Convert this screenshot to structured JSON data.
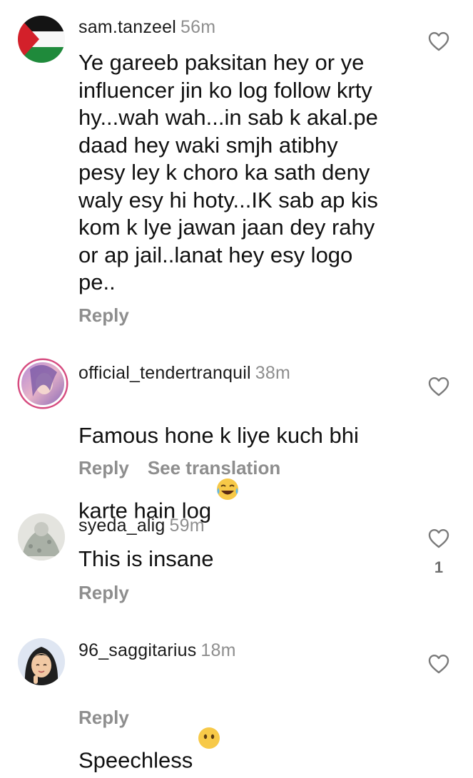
{
  "comments": [
    {
      "username": "sam.tanzeel",
      "time": "56m",
      "text": "Ye gareeb paksitan hey or ye\ninfluencer jin ko log follow krty\nhy...wah wah...in sab k akal.pe\ndaad hey waki smjh atibhy\npesy ley k choro ka sath deny\nwaly esy hi hoty...IK sab ap kis\nkom k lye jawan jaan dey rahy\nor ap jail..lanat hey esy logo\npe..",
      "reply_label": "Reply",
      "avatar_icon": "palestine-flag-icon"
    },
    {
      "username": "official_tendertranquil",
      "time": "38m",
      "text": "Famous hone k liye kuch bhi\nkarte hain log",
      "emoji": "tears-of-joy-emoji",
      "reply_label": "Reply",
      "translation_label": "See translation",
      "avatar_icon": "profile-photo-icon"
    },
    {
      "username": "syeda_alig",
      "time": "59m",
      "text": "This is insane",
      "reply_label": "Reply",
      "like_count": "1",
      "avatar_icon": "profile-photo-icon"
    },
    {
      "username": "96_saggitarius",
      "time": "18m",
      "text": "Speechless",
      "emoji": "no-mouth-face-emoji",
      "reply_label": "Reply",
      "avatar_icon": "cartoon-girl-avatar-icon"
    }
  ],
  "colors": {
    "secondary_text": "#8e8e8e",
    "story_ring": "#d64c80"
  }
}
